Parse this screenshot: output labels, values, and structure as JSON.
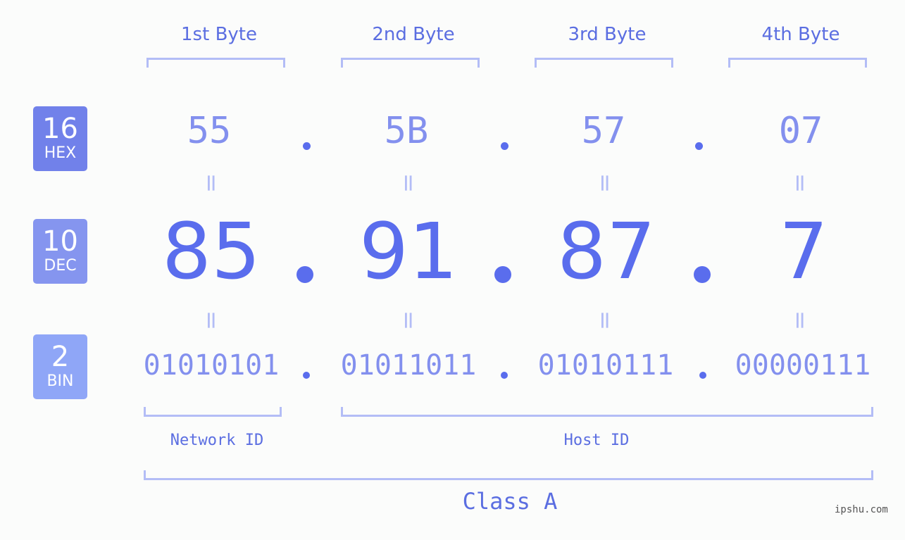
{
  "byte_headers": [
    "1st Byte",
    "2nd Byte",
    "3rd Byte",
    "4th Byte"
  ],
  "badges": [
    {
      "number": "16",
      "label": "HEX",
      "color": "#7181ea"
    },
    {
      "number": "10",
      "label": "DEC",
      "color": "#8595ef"
    },
    {
      "number": "2",
      "label": "BIN",
      "color": "#8fa6f7"
    }
  ],
  "hex": [
    "55",
    "5B",
    "57",
    "07"
  ],
  "dec": [
    "85",
    "91",
    "87",
    "7"
  ],
  "bin": [
    "01010101",
    "01011011",
    "01010111",
    "00000111"
  ],
  "equals_sign": "=",
  "network_label": "Network ID",
  "host_label": "Host ID",
  "class_label": "Class A",
  "watermark": "ipshu.com",
  "colors": {
    "accent": "#5a6ded",
    "light": "#8390ee",
    "bracket": "#b3bdf6"
  }
}
